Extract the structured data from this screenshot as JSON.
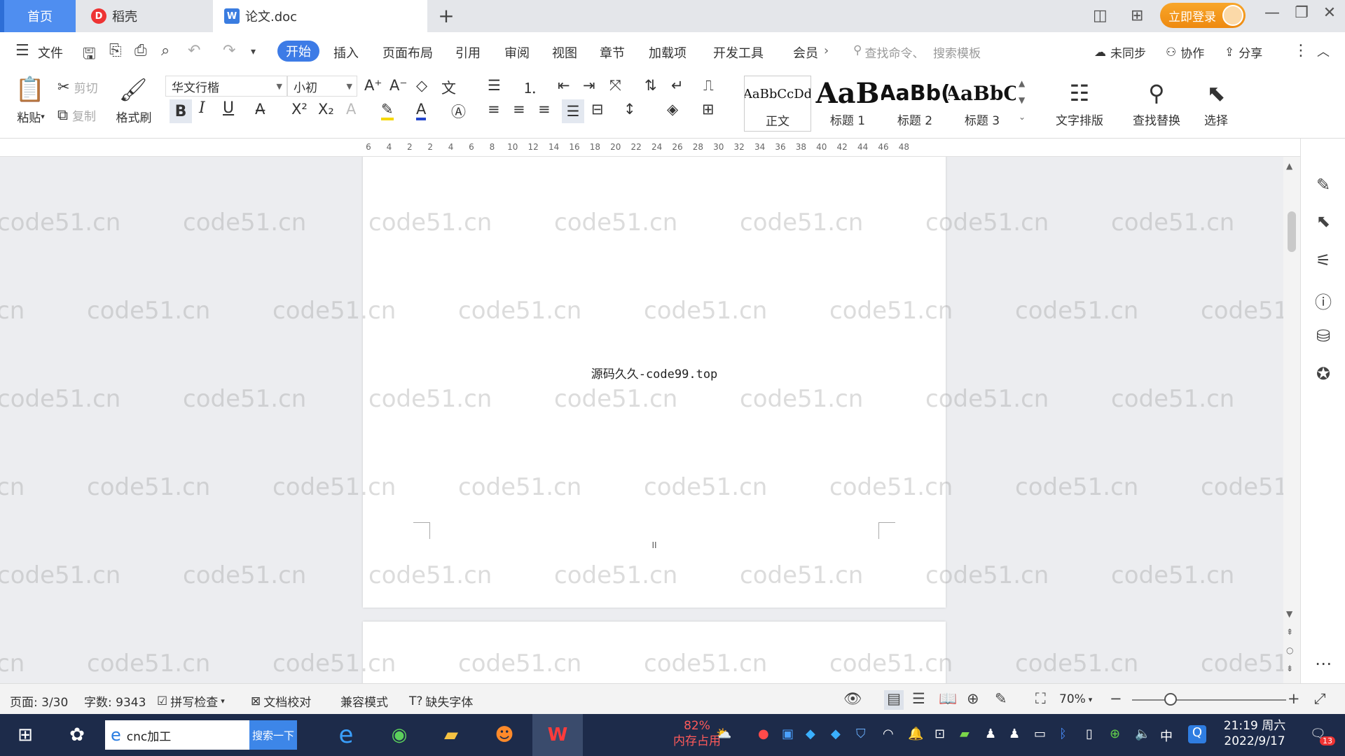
{
  "tabs": {
    "home": "首页",
    "daoke": "稻壳",
    "document": "论文.doc",
    "new_tab": "+"
  },
  "window": {
    "login": "立即登录",
    "minimize": "—",
    "restore": "❐",
    "close": "✕"
  },
  "menu": {
    "file": "文件",
    "start": "开始",
    "items": [
      "插入",
      "页面布局",
      "引用",
      "审阅",
      "视图",
      "章节",
      "加载项",
      "开发工具",
      "会员"
    ],
    "more": "›",
    "cmd_search": "查找命令、",
    "tpl_search": "搜索模板",
    "unsynced": "未同步",
    "collab": "协作",
    "share": "分享"
  },
  "ribbon": {
    "paste": "粘贴",
    "cut": "剪切",
    "copy": "复制",
    "format_painter": "格式刷",
    "font_name": "华文行楷",
    "font_size": "小初",
    "styles": [
      {
        "sample": "AaBbCcDd",
        "name": "正文"
      },
      {
        "sample": "AaB",
        "name": "标题 1"
      },
      {
        "sample": "AaBb(",
        "name": "标题 2"
      },
      {
        "sample": "AaBbC",
        "name": "标题 3"
      }
    ],
    "text_layout": "文字排版",
    "find_replace": "查找替换",
    "select": "选择"
  },
  "ruler": {
    "ticks": [
      "6",
      "4",
      "2",
      "2",
      "4",
      "6",
      "8",
      "10",
      "12",
      "14",
      "16",
      "18",
      "20",
      "22",
      "24",
      "26",
      "28",
      "30",
      "32",
      "34",
      "36",
      "38",
      "40",
      "42",
      "44",
      "46",
      "48"
    ]
  },
  "document": {
    "body_text": "源码久久-code99.top",
    "page_number": "II",
    "watermark": "code51.cn"
  },
  "status": {
    "page": "页面: 3/30",
    "words": "字数: 9343",
    "spell": "拼写检查",
    "proof": "文档校对",
    "compat": "兼容模式",
    "missing_font": "缺失字体",
    "zoom": "70%",
    "zoom_level": 0.25
  },
  "taskbar": {
    "search_text": "cnc加工",
    "search_button": "搜索一下",
    "mem_percent": "82%",
    "mem_label": "内存占用",
    "time": "21:19 周六",
    "date": "2022/9/17",
    "notify_count": "13",
    "ime": "中"
  }
}
